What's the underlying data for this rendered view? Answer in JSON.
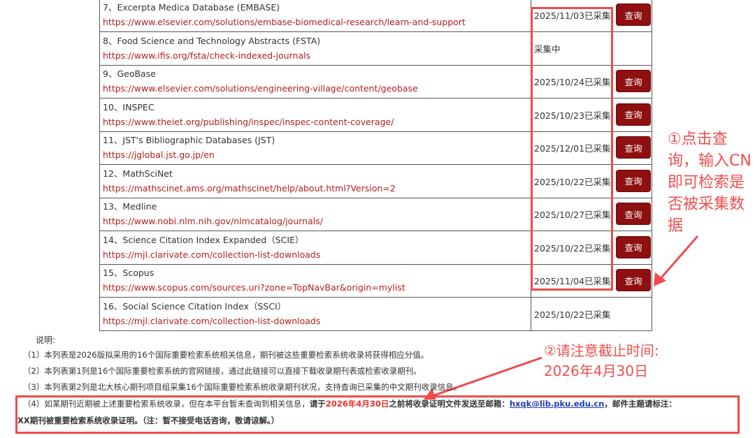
{
  "rows": [
    {
      "name": "7、Excerpta Medica Database (EMBASE)",
      "url": "https://www.elsevier.com/solutions/embase-biomedical-research/learn-and-support",
      "status": "2025/11/03已采集",
      "button": "查询"
    },
    {
      "name": "8、Food Science and Technology Abstracts (FSTA)",
      "url": "https://www.ifis.org/fsta/check-indexed-journals",
      "status": "采集中",
      "button": ""
    },
    {
      "name": "9、GeoBase",
      "url": "https://www.elsevier.com/solutions/engineering-village/content/geobase",
      "status": "2025/10/24已采集",
      "button": "查询"
    },
    {
      "name": "10、INSPEC",
      "url": "https://www.theiet.org/publishing/inspec/inspec-content-coverage/",
      "status": "2025/10/23已采集",
      "button": "查询"
    },
    {
      "name": "11、JST's Bibliographic Databases (JST)",
      "url": "https://jglobal.jst.go.jp/en",
      "status": "2025/12/01已采集",
      "button": "查询"
    },
    {
      "name": "12、MathSciNet",
      "url": "https://mathscinet.ams.org/mathscinet/help/about.html?Version=2",
      "status": "2025/10/22已采集",
      "button": "查询"
    },
    {
      "name": "13、Medline",
      "url": "https://www.nobi.nlm.nih.gov/nlmcatalog/journals/",
      "status": "2025/10/27已采集",
      "button": "查询"
    },
    {
      "name": "14、Science Citation Index Expanded（SCIE）",
      "url": "https://mjl.clarivate.com/collection-list-downloads",
      "status": "2025/10/22已采集",
      "button": "查询"
    },
    {
      "name": "15、Scopus",
      "url": "https://www.scopus.com/sources.uri?zone=TopNavBar&origin=mylist",
      "status": "2025/11/04已采集",
      "button": "查询"
    },
    {
      "name": "16、Social Science Citation Index（SSCI）",
      "url": "https://mjl.clarivate.com/collection-list-downloads",
      "status": "2025/10/22已采集",
      "button": ""
    }
  ],
  "annotations": {
    "a1": "①点击查询，输入CN即可检索是否被采集数据",
    "a2_line1": "②请注意截止时间:",
    "a2_line2": "2026年4月30日"
  },
  "notes": {
    "title": "说明:",
    "n1": "（1）本列表是2026版拟采用的16个国际重要检索系统相关信息，期刊被这些重要检索系统收录将获得相应分值。",
    "n2": "（2）本列表第1列是16个国际重要检索系统的官网链接，通过此链接可以直接下载收录期刊表或检索收录期刊。",
    "n3": "（3）本列表第2列是北大核心期刊项目组采集16个国际重要检索系统收录期刊状况，支持查询已采集的中文期刊收录信息。",
    "n4_part1": "（4）如某期刊近期被上述重要检索系统收录，但在本平台暂未查询到相关信息，",
    "n4_part2": "请于",
    "n4_date": "2026年4月30日",
    "n4_part3": "之前将收录证明文件发送至邮箱：",
    "n4_email": "hxqk@lib.pku.edu.cn",
    "n4_part4": "，邮件主题请标注：",
    "n4_line2": "XX期刊被重要检索系统收录证明。（注：暂不接受电话咨询，敬请谅解。）"
  },
  "colors": {
    "accent_red": "#ee4b4b",
    "button_bg": "#8e1010",
    "url_red": "#b21f1f",
    "email_blue": "#1e3fb4"
  }
}
